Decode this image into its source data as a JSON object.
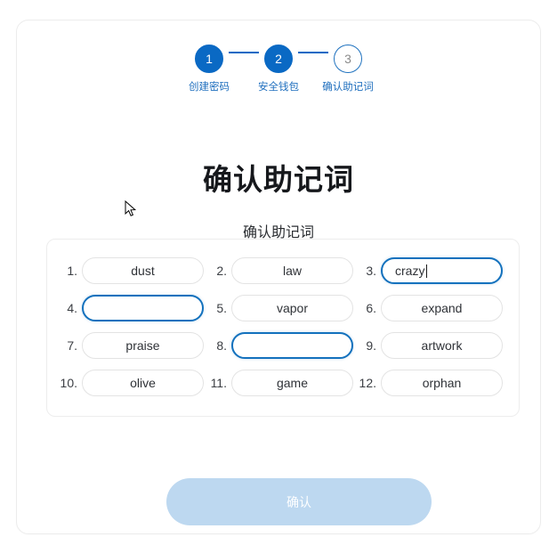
{
  "stepper": {
    "steps": [
      {
        "number": "1",
        "label": "创建密码",
        "state": "done"
      },
      {
        "number": "2",
        "label": "安全钱包",
        "state": "done"
      },
      {
        "number": "3",
        "label": "确认助记词",
        "state": "todo"
      }
    ]
  },
  "heading": {
    "title": "确认助记词",
    "subtitle": "确认助记词"
  },
  "word_grid": {
    "rows": [
      [
        {
          "index": "1.",
          "value": "dust",
          "state": "filled"
        },
        {
          "index": "2.",
          "value": "law",
          "state": "filled"
        },
        {
          "index": "3.",
          "value": "crazy",
          "state": "focused"
        }
      ],
      [
        {
          "index": "4.",
          "value": "",
          "state": "empty-active"
        },
        {
          "index": "5.",
          "value": "vapor",
          "state": "filled"
        },
        {
          "index": "6.",
          "value": "expand",
          "state": "filled"
        }
      ],
      [
        {
          "index": "7.",
          "value": "praise",
          "state": "filled"
        },
        {
          "index": "8.",
          "value": "",
          "state": "empty-active"
        },
        {
          "index": "9.",
          "value": "artwork",
          "state": "filled"
        }
      ],
      [
        {
          "index": "10.",
          "value": "olive",
          "state": "filled"
        },
        {
          "index": "11.",
          "value": "game",
          "state": "filled"
        },
        {
          "index": "12.",
          "value": "orphan",
          "state": "filled"
        }
      ]
    ]
  },
  "actions": {
    "confirm_label": "确认"
  },
  "colors": {
    "accent": "#0a69c4",
    "accent_link": "#1f6fbe",
    "focus_border": "#1371bd",
    "button_disabled_bg": "#bdd8f0",
    "card_border": "#ececec",
    "pill_border": "#e3e3e3"
  }
}
